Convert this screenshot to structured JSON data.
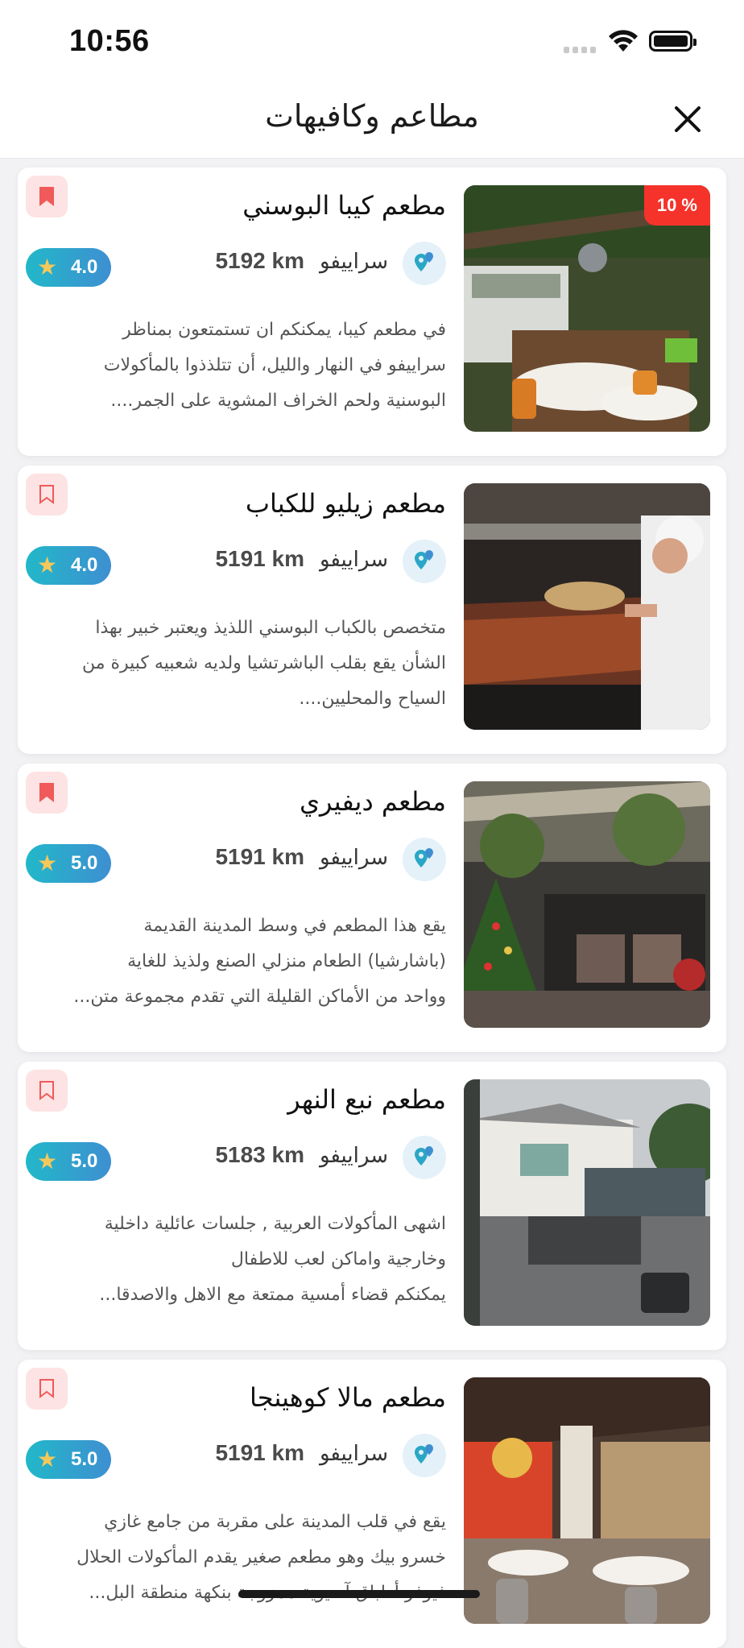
{
  "status": {
    "time": "10:56"
  },
  "header": {
    "title": "مطاعم وكافيهات"
  },
  "restaurants": [
    {
      "name": "مطعم كيبا البوسني",
      "city": "سراييفو",
      "distance": "5192 km",
      "rating": "4.0",
      "discount": "10 %",
      "bookmarked": true,
      "description": [
        "في مطعم كيبا، يمكنكم ان تستمتعون بمناظر",
        "سراييفو في النهار والليل، أن تتلذذوا بالمأكولات",
        "البوسنية ولحم الخراف المشوية على الجمر...."
      ]
    },
    {
      "name": "مطعم زيليو للكباب",
      "city": "سراييفو",
      "distance": "5191 km",
      "rating": "4.0",
      "bookmarked": false,
      "description": [
        "متخصص بالكباب البوسني اللذيذ ويعتبر خبير بهذا",
        "الشأن يقع بقلب الباشرتشيا ولديه شعبيه كبيرة من",
        "السياح والمحليين...."
      ]
    },
    {
      "name": "مطعم ديفيري",
      "city": "سراييفو",
      "distance": "5191 km",
      "rating": "5.0",
      "bookmarked": true,
      "description": [
        "يقع هذا المطعم في وسط المدينة  القديمة",
        "(باشارشيا) الطعام منزلي الصنع ولذيذ للغاية",
        "وواحد من الأماكن القليلة التي تقدم مجموعة متن..."
      ]
    },
    {
      "name": "مطعم نبع النهر",
      "city": "سراييفو",
      "distance": "5183 km",
      "rating": "5.0",
      "bookmarked": false,
      "description": [
        "اشهى المأكولات العربية , جلسات عائلية داخلية",
        "وخارجية واماكن لعب للاطفال",
        "يمكنكم قضاء أمسية ممتعة مع الاهل والاصدقا..."
      ]
    },
    {
      "name": "مطعم مالا كوهينجا",
      "city": "سراييفو",
      "distance": "5191 km",
      "rating": "5.0",
      "bookmarked": false,
      "description": [
        "يقع في قلب المدينة على مقربة من جامع غازي",
        "خسرو بيك وهو مطعم صغير يقدم المأكولات الحلال",
        "فيوفر أطباق آسيوية ممزوجة بنكهة منطقة البل..."
      ]
    }
  ]
}
